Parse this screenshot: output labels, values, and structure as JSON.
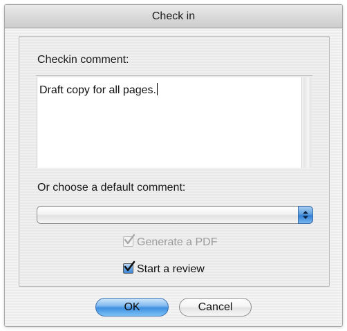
{
  "window": {
    "title": "Check in"
  },
  "comment": {
    "label": "Checkin comment:",
    "text": "Draft copy for all pages."
  },
  "default_comment": {
    "label": "Or choose a default comment:",
    "selected": ""
  },
  "options": {
    "generate_pdf": {
      "label": "Generate a PDF",
      "checked": true,
      "enabled": false
    },
    "start_review": {
      "label": "Start a review",
      "checked": true,
      "enabled": true
    }
  },
  "buttons": {
    "ok_label": "OK",
    "cancel_label": "Cancel"
  },
  "colors": {
    "accent": "#3f90e0"
  }
}
